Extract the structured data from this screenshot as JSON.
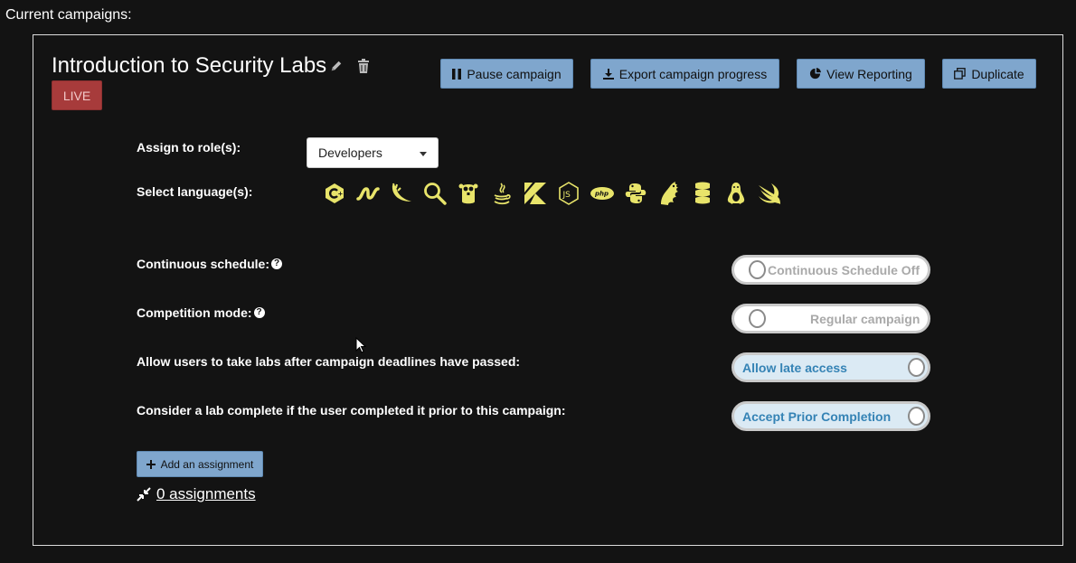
{
  "page": {
    "heading": "Current campaigns:"
  },
  "campaign": {
    "title": "Introduction to Security Labs",
    "status_badge": "LIVE",
    "actions": {
      "pause": "Pause campaign",
      "export": "Export campaign progress",
      "reporting": "View Reporting",
      "duplicate": "Duplicate"
    },
    "role": {
      "label": "Assign to role(s):",
      "selected": "Developers"
    },
    "languages": {
      "label": "Select language(s):",
      "icons": [
        "c-sharp-icon",
        "nim-icon",
        "dart-icon",
        "search-icon",
        "go-gopher-icon",
        "java-icon",
        "kotlin-icon",
        "nodejs-icon",
        "php-icon",
        "python-icon",
        "scala-icon",
        "rust-icon",
        "linux-icon",
        "swift-icon"
      ]
    },
    "settings": [
      {
        "label": "Continuous schedule:",
        "help": "?",
        "toggle_text": "Continuous Schedule Off",
        "state": "off"
      },
      {
        "label": "Competition mode:",
        "help": "?",
        "toggle_text": "Regular campaign",
        "state": "off"
      },
      {
        "label": "Allow users to take labs after campaign deadlines have passed:",
        "toggle_text": "Allow late access",
        "state": "on"
      },
      {
        "label": "Consider a lab complete if the user completed it prior to this campaign:",
        "toggle_text": "Accept Prior Completion",
        "state": "on"
      }
    ],
    "add_assignment": "Add an assignment",
    "assignments_link": "0 assignments"
  },
  "colors": {
    "background": "#131313",
    "button": "#7fa6cd",
    "live_badge": "#a73b3b",
    "icon_yellow": "#e8e46a",
    "toggle_on_text": "#3583b5"
  }
}
